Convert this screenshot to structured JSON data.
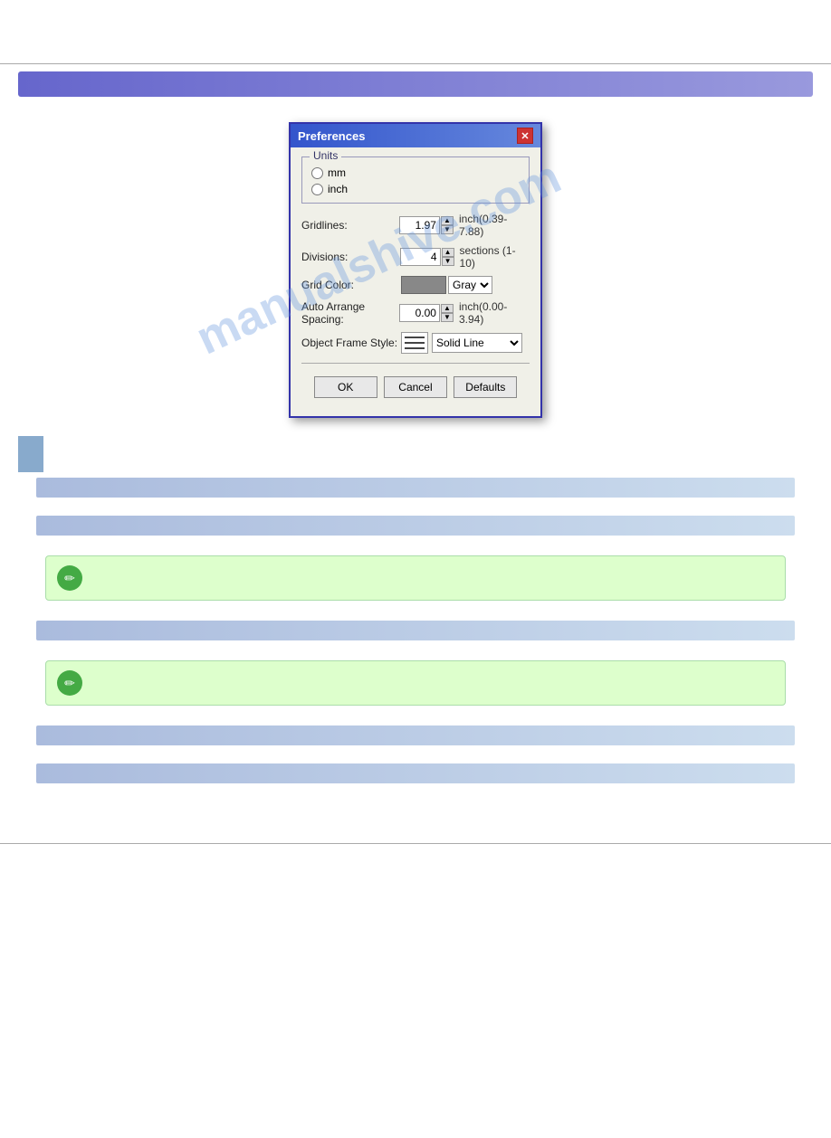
{
  "header": {
    "bar_label": ""
  },
  "dialog": {
    "title": "Preferences",
    "units_group_label": "Units",
    "radio_mm": "mm",
    "radio_inch": "inch",
    "gridlines_label": "Gridlines:",
    "gridlines_value": "1.97",
    "gridlines_hint": "inch(0.39-7.88)",
    "divisions_label": "Divisions:",
    "divisions_value": "4",
    "divisions_hint": "sections (1-10)",
    "grid_color_label": "Grid Color:",
    "grid_color_name": "Gray",
    "auto_arrange_label": "Auto Arrange Spacing:",
    "auto_arrange_value": "0.00",
    "auto_arrange_hint": "inch(0.00-3.94)",
    "object_frame_label": "Object Frame Style:",
    "object_frame_value": "Solid Line",
    "btn_ok": "OK",
    "btn_cancel": "Cancel",
    "btn_defaults": "Defaults"
  },
  "watermark": {
    "text": "manualshive.com"
  },
  "sections": [
    {
      "id": "s1",
      "label": ""
    },
    {
      "id": "s2",
      "label": ""
    },
    {
      "id": "s3",
      "label": ""
    },
    {
      "id": "s4",
      "label": ""
    },
    {
      "id": "s5",
      "label": ""
    },
    {
      "id": "s6",
      "label": ""
    }
  ],
  "notes": [
    {
      "id": "n1"
    },
    {
      "id": "n2"
    }
  ]
}
